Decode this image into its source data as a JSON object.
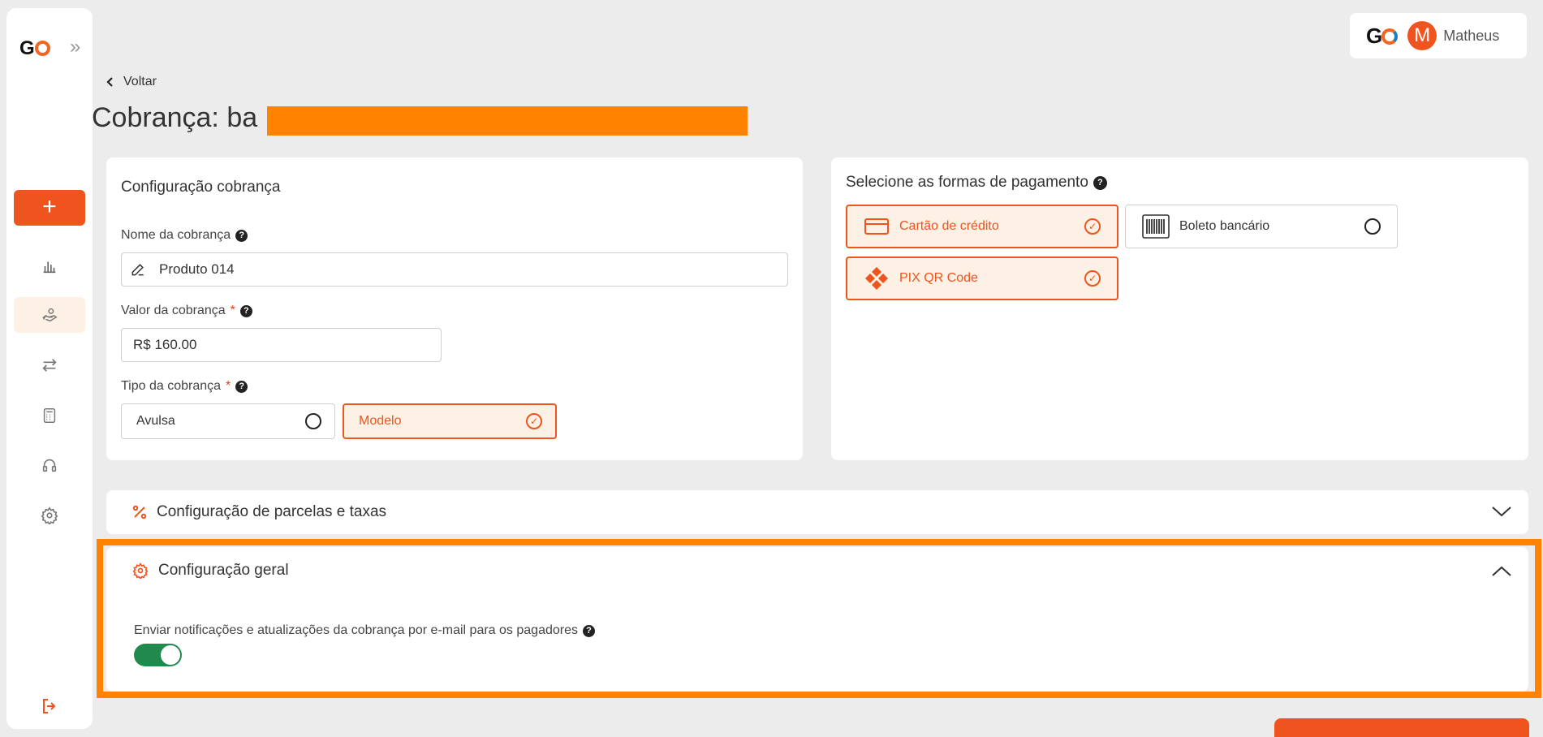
{
  "brand": {
    "logo_text": "GO"
  },
  "nav": {
    "add_label": "+",
    "items": [
      "dashboard",
      "charges",
      "transfers",
      "calculator",
      "support",
      "settings"
    ]
  },
  "user": {
    "initial": "M",
    "name": "Matheus"
  },
  "page": {
    "back_label": "Voltar",
    "title": "Cobrança: ba"
  },
  "config": {
    "card_title": "Configuração cobrança",
    "name_label": "Nome da cobrança",
    "name_value": "Produto 014",
    "value_label": "Valor da cobrança",
    "value_required": "*",
    "value_value": "R$ 160.00",
    "type_label": "Tipo da cobrança",
    "type_required": "*",
    "type_options": [
      {
        "label": "Avulsa",
        "selected": false
      },
      {
        "label": "Modelo",
        "selected": true
      }
    ]
  },
  "payment": {
    "title": "Selecione as formas de pagamento",
    "methods": [
      {
        "label": "Cartão de crédito",
        "icon": "credit-card-icon",
        "selected": true
      },
      {
        "label": "Boleto bancário",
        "icon": "barcode-icon",
        "selected": false
      },
      {
        "label": "PIX QR Code",
        "icon": "pix-icon",
        "selected": true
      }
    ]
  },
  "sections": {
    "installments_title": "Configuração de parcelas e taxas",
    "general_title": "Configuração geral",
    "email_notify_label": "Enviar notificações e atualizações da cobrança por e-mail para os pagadores",
    "email_notify_enabled": true
  },
  "colors": {
    "accent": "#f0541e",
    "highlight": "#ff8200",
    "toggle_on": "#1f8a4c"
  }
}
